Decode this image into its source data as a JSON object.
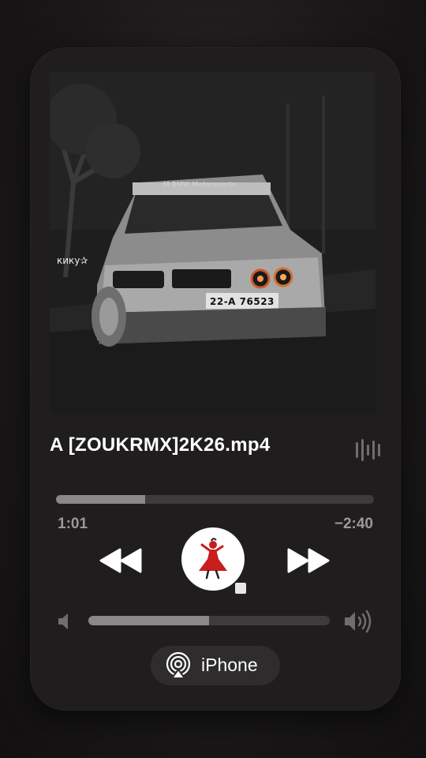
{
  "artwork": {
    "caption": "кику✰",
    "plate": "22-A 76523",
    "brand": "M BMW Motorsports"
  },
  "track": {
    "title": "A [ZOUKRMX]2K26.mp4"
  },
  "playback": {
    "elapsed": "1:01",
    "remaining": "−2:40",
    "progress": 0.28
  },
  "controls": {
    "rewind_icon": "rewind-icon",
    "play_icon": "dancer-icon",
    "forward_icon": "fast-forward-icon",
    "waveform_icon": "waveform-icon"
  },
  "volume": {
    "level": 0.5
  },
  "output": {
    "device": "iPhone",
    "icon": "airplay-icon"
  },
  "colors": {
    "card": "#1f1d1e",
    "track": "#3d3b3c",
    "fill": "#8a8889",
    "accent_red": "#c81e1e"
  }
}
